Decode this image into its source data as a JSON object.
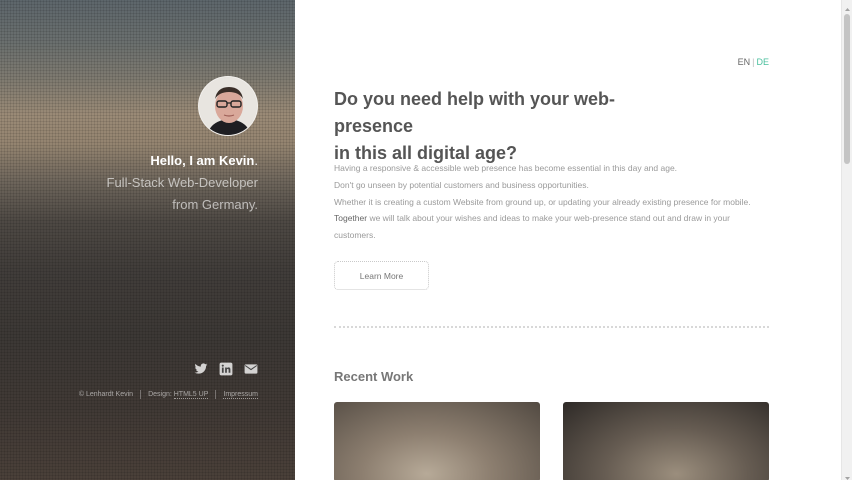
{
  "sidebar": {
    "greeting": "Hello, I am Kevin",
    "greeting_dot": ".",
    "role": "Full-Stack Web-Developer",
    "location": "from Germany.",
    "socials": [
      "twitter-icon",
      "linkedin-icon",
      "email-icon"
    ],
    "footer": {
      "copyright": "© Lenhardt Kevin",
      "design_label": "Design:",
      "design_link": "HTML5 UP",
      "impressum": "Impressum"
    }
  },
  "main": {
    "language": {
      "en": "EN",
      "separator": "|",
      "de": "DE"
    },
    "headline_line1": "Do you need help with your web-presence",
    "headline_line2": "in this all digital age?",
    "paragraph": {
      "line1": "Having a responsive & accessible web presence has become essential in this day and age.",
      "line2": "Don't go unseen by potential customers and business opportunities.",
      "line3": "Whether it is creating a custom Website from ground up, or updating your already existing presence for mobile.",
      "line4_strong": "Together",
      "line4_rest": " we will talk about your wishes and ideas to make your web-presence stand out and draw in your",
      "line5": "customers."
    },
    "learn_more": "Learn More",
    "recent_work_title": "Recent Work"
  },
  "colors": {
    "accent": "#49bf9d",
    "text": "#555555",
    "muted": "#9a9a9a"
  }
}
